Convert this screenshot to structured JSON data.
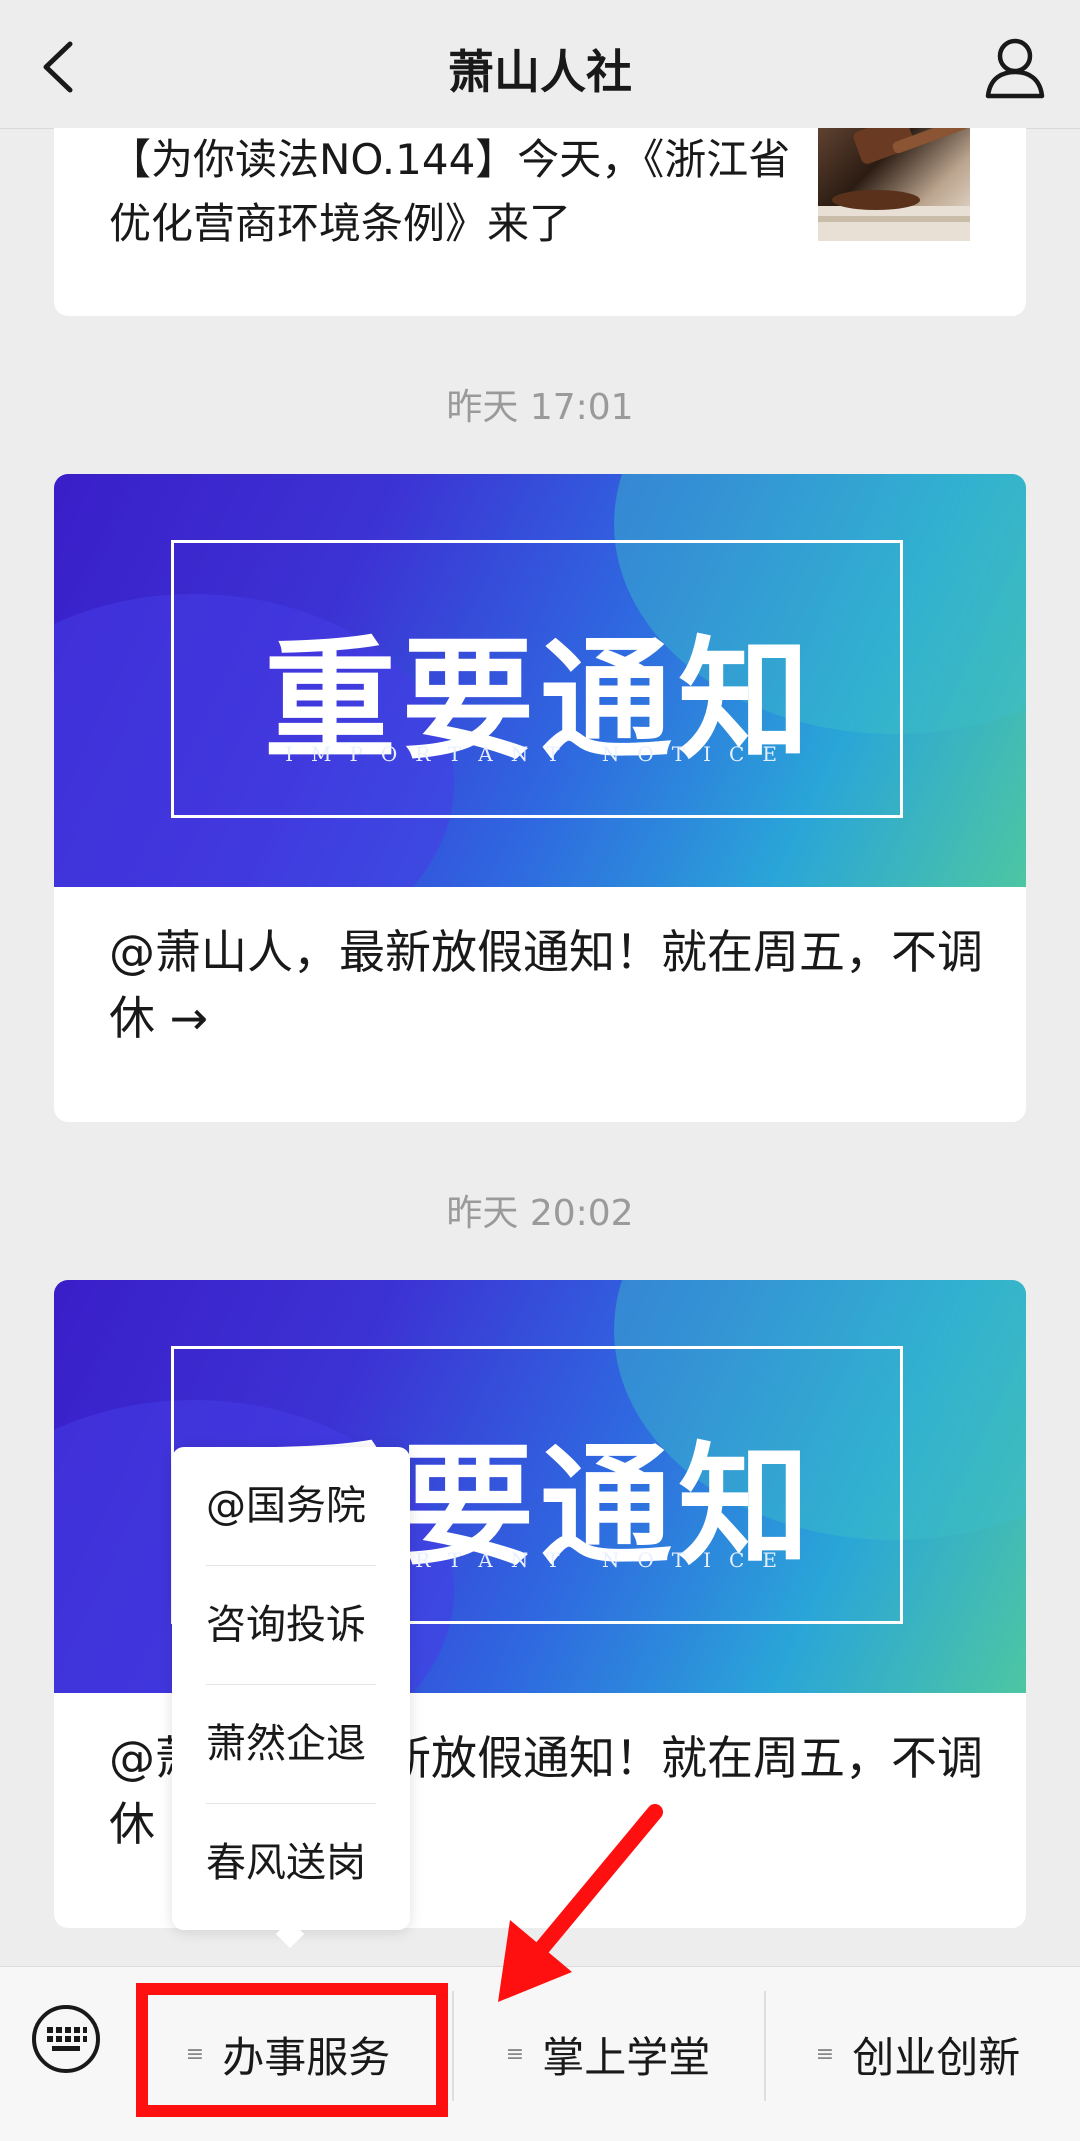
{
  "header": {
    "title": "萧山人社",
    "back_icon": "chevron-left-icon",
    "profile_icon": "person-icon"
  },
  "messages": [
    {
      "type": "article",
      "text": "【为你读法NO.144】今天，《浙江省优化营商环境条例》来了",
      "thumb_icon": "gavel-image"
    },
    {
      "time": "昨天 17:01",
      "banner_title": "重要通知",
      "banner_sub": "IMPORTANT NOTICE",
      "caption": "@萧山人，最新放假通知！就在周五，不调休 →"
    },
    {
      "time": "昨天 20:02",
      "banner_title": "重要通知",
      "banner_sub": "IMPORTANT NOTICE",
      "caption": "@萧山人，最新放假通知！就在周五，不调休 →"
    }
  ],
  "popup_menu": {
    "items": [
      "@国务院",
      "咨询投诉",
      "萧然企退",
      "春风送岗"
    ]
  },
  "bottom_menu": {
    "keyboard_icon": "keyboard-icon",
    "items": [
      {
        "label": "办事服务",
        "icon": "menu-lines-icon"
      },
      {
        "label": "掌上学堂",
        "icon": "menu-lines-icon"
      },
      {
        "label": "创业创新",
        "icon": "menu-lines-icon"
      }
    ]
  },
  "annotations": {
    "highlight_color": "#ff1010"
  }
}
